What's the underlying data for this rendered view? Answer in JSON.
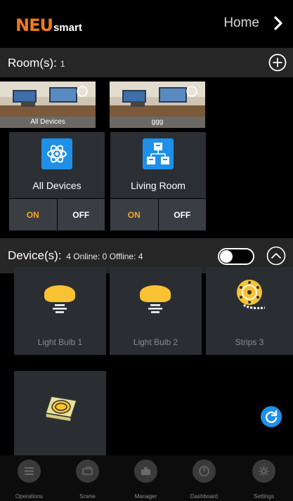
{
  "header": {
    "logo_neu": "NEU",
    "logo_smart": "smart",
    "home_label": "Home"
  },
  "rooms": {
    "title": "Room(s):",
    "count": "1",
    "thumbnails": [
      {
        "label": "All Devices"
      },
      {
        "label": "ggg"
      }
    ],
    "cards": [
      {
        "name": "All Devices",
        "on": "ON",
        "off": "OFF",
        "icon": "atom-icon"
      },
      {
        "name": "Living Room",
        "on": "ON",
        "off": "OFF",
        "icon": "hierarchy-icon"
      }
    ]
  },
  "devices": {
    "title": "Device(s):",
    "stats": "4  Online: 0  Offline: 4",
    "toggle_on": false,
    "items": [
      {
        "name": "Light Bulb 1",
        "icon": "bulb-icon"
      },
      {
        "name": "Light Bulb 2",
        "icon": "bulb-icon"
      },
      {
        "name": "Strips 3",
        "icon": "light-strip-icon"
      },
      {
        "name": "",
        "icon": "smart-plug-icon"
      }
    ]
  },
  "tabs": [
    {
      "label": "Operations",
      "icon": "list-icon"
    },
    {
      "label": "Scene",
      "icon": "scene-icon"
    },
    {
      "label": "Manager",
      "icon": "manager-icon"
    },
    {
      "label": "Dashboard",
      "icon": "gauge-icon"
    },
    {
      "label": "Settings",
      "icon": "gear-icon"
    }
  ],
  "colors": {
    "brand": "#f07a1a",
    "accent_on": "#f5a623",
    "tile_blue": "#1e90e8"
  }
}
